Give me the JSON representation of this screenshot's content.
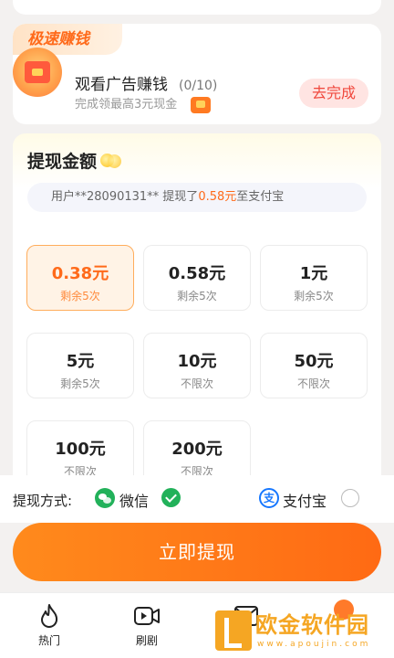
{
  "speed_earn": {
    "tag": "极速赚钱",
    "task": {
      "title": "观看广告赚钱",
      "progress": "(0/10)",
      "description": "完成领最高3元现金",
      "action_label": "去完成"
    }
  },
  "withdraw": {
    "title": "提现金额",
    "ticker": {
      "prefix": "用户**28090131** 提现了",
      "amount": "0.58元",
      "suffix": "至支付宝"
    },
    "options": [
      {
        "amount": "0.38元",
        "remaining": "剩余5次",
        "selected": true
      },
      {
        "amount": "0.58元",
        "remaining": "剩余5次",
        "selected": false
      },
      {
        "amount": "1元",
        "remaining": "剩余5次",
        "selected": false
      },
      {
        "amount": "5元",
        "remaining": "剩余5次",
        "selected": false
      },
      {
        "amount": "10元",
        "remaining": "不限次",
        "selected": false
      },
      {
        "amount": "50元",
        "remaining": "不限次",
        "selected": false
      },
      {
        "amount": "100元",
        "remaining": "不限次",
        "selected": false
      },
      {
        "amount": "200元",
        "remaining": "不限次",
        "selected": false
      }
    ]
  },
  "method": {
    "label": "提现方式:",
    "wechat": {
      "label": "微信",
      "selected": true,
      "icon": "wechat-icon"
    },
    "alipay": {
      "label": "支付宝",
      "selected": false,
      "icon": "alipay-icon"
    }
  },
  "submit_label": "立即提现",
  "nav": [
    {
      "label": "热门",
      "icon": "flame-icon"
    },
    {
      "label": "刷剧",
      "icon": "video-icon"
    }
  ],
  "watermark": {
    "text": "欧金软件园",
    "url": "www.apoujin.com"
  },
  "colors": {
    "accent": "#ff6a1a",
    "wechat": "#22b15a",
    "alipay": "#1677ff"
  }
}
